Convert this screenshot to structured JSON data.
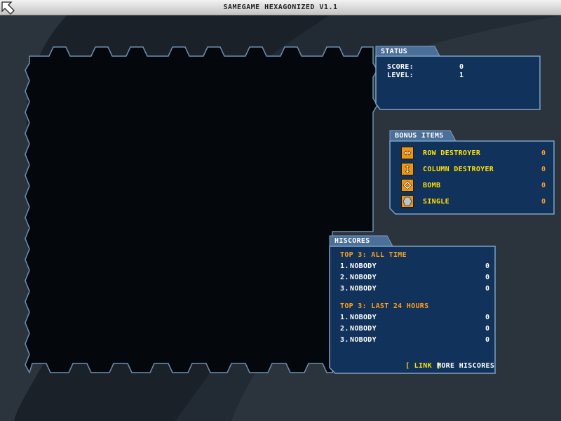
{
  "window": {
    "title": "SAMEGAME HEXAGONIZED V1.1"
  },
  "status": {
    "header": "STATUS",
    "score_label": "SCORE:",
    "score_value": "0",
    "level_label": "LEVEL:",
    "level_value": "1"
  },
  "bonus": {
    "header": "BONUS ITEMS",
    "items": [
      {
        "label": "ROW DESTROYER",
        "count": "0",
        "icon": "row-destroyer-icon"
      },
      {
        "label": "COLUMN DESTROYER",
        "count": "0",
        "icon": "column-destroyer-icon"
      },
      {
        "label": "BOMB",
        "count": "0",
        "icon": "bomb-icon"
      },
      {
        "label": "SINGLE",
        "count": "0",
        "icon": "single-icon"
      }
    ]
  },
  "hiscores": {
    "header": "HISCORES",
    "all_time": {
      "title": "TOP 3: ALL TIME",
      "entries": [
        {
          "rank": "1.",
          "name": "NOBODY",
          "score": "0"
        },
        {
          "rank": "2.",
          "name": "NOBODY",
          "score": "0"
        },
        {
          "rank": "3.",
          "name": "NOBODY",
          "score": "0"
        }
      ]
    },
    "last_24": {
      "title": "TOP 3: LAST 24 HOURS",
      "entries": [
        {
          "rank": "1.",
          "name": "NOBODY",
          "score": "0"
        },
        {
          "rank": "2.",
          "name": "NOBODY",
          "score": "0"
        },
        {
          "rank": "3.",
          "name": "NOBODY",
          "score": "0"
        }
      ]
    },
    "link_label": "[ LINK ]",
    "more_label": "MORE HISCORES"
  },
  "colors": {
    "background": "#2b333c",
    "panel_fill": "#11325a",
    "panel_border": "#7ea2c4",
    "tab_fill": "#4a6f99",
    "label_yellow": "#ffe000",
    "label_orange": "#ff9e1a",
    "board_fill": "#04070b"
  }
}
